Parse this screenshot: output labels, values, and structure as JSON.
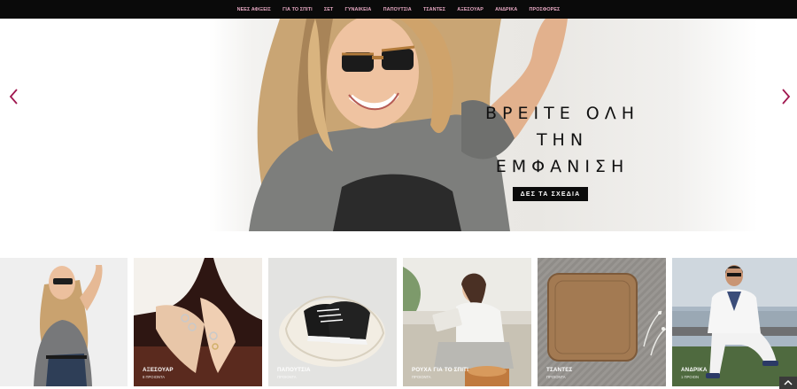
{
  "nav": {
    "items": [
      "ΝΕΕΣ ΑΦΙΞΕΙΣ",
      "ΓΙΑ ΤΟ ΣΠΙΤΙ",
      "ΣΕΤ",
      "ΓΥΝΑΙΚΕΙΑ",
      "ΠΑΠΟΥΤΣΙΑ",
      "ΤΣΑΝΤΕΣ",
      "ΑΞΕΣΟΥΑΡ",
      "ΑΝΔΡΙΚΑ",
      "ΠΡΟΣΦΟΡΕΣ"
    ]
  },
  "hero": {
    "line1": "ΒΡΕΙΤΕ ΟΛΗ",
    "line2": "ΤΗΝ",
    "line3": "ΕΜΦΑΝΙΣΗ",
    "button_label": "ΔΕΣ ΤΑ ΣΧΕΔΙΑ",
    "prev_icon": "chevron-left-icon",
    "next_icon": "chevron-right-icon",
    "arrow_color": "#a0174f"
  },
  "categories": [
    {
      "title": "",
      "subtitle": ""
    },
    {
      "title": "ΑΞΕΣΟΥΑΡ",
      "subtitle": "8 ΠΡΟΙΟΝΤΑ"
    },
    {
      "title": "ΠΑΠΟΥΤΣΙΑ",
      "subtitle": "ΠΡΟΙΟΝΤΑ"
    },
    {
      "title": "ΡΟΥΧΑ ΓΙΑ ΤΟ ΣΠΙΤΙ",
      "subtitle": "ΠΡΟΙΟΝΤΑ"
    },
    {
      "title": "ΤΣΑΝΤΕΣ",
      "subtitle": "ΠΡΟΙΟΝΤΑ"
    },
    {
      "title": "ΑΝΔΡΙΚΑ",
      "subtitle": "1 ΠΡΟΙΟΝ"
    }
  ],
  "colors": {
    "nav_bg": "#0a0a0a",
    "nav_text": "#e8a9c4",
    "button_bg": "#0b0b0b"
  },
  "scroll_top_icon": "chevron-up-icon"
}
